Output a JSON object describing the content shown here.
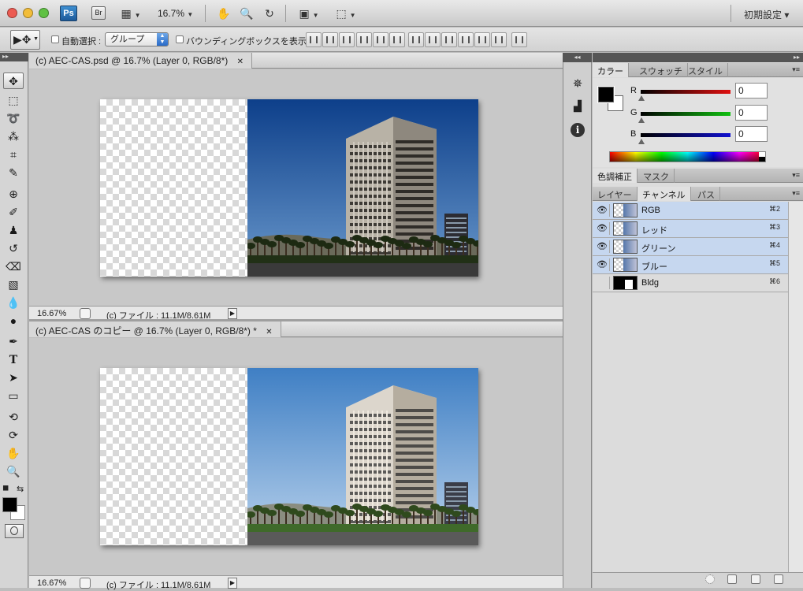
{
  "app": {
    "logo": "Ps",
    "bridge": "Br",
    "zoom": "16.7%",
    "workspace": "初期設定 ▾"
  },
  "options": {
    "auto_select_label": "自動選択 :",
    "auto_select_value": "グループ",
    "bounding_box_label": "バウンディングボックスを表示"
  },
  "documents": [
    {
      "tab_title": "(c) AEC-CAS.psd @ 16.7% (Layer 0, RGB/8*)",
      "status_zoom": "16.67%",
      "status_file": "(c) ファイル : 11.1M/8.61M"
    },
    {
      "tab_title": "(c) AEC-CAS のコピー @ 16.7% (Layer 0, RGB/8*) *",
      "status_zoom": "16.67%",
      "status_file": "(c) ファイル : 11.1M/8.61M"
    }
  ],
  "color_panel": {
    "tabs": [
      "カラー",
      "スウォッチ",
      "スタイル"
    ],
    "sliders": [
      {
        "label": "R",
        "value": "0",
        "color": "#e01010"
      },
      {
        "label": "G",
        "value": "0",
        "color": "#10c010"
      },
      {
        "label": "B",
        "value": "0",
        "color": "#1010d0"
      }
    ],
    "foreground": "#000000",
    "background": "#ffffff"
  },
  "adjust_panel": {
    "tabs": [
      "色調補正",
      "マスク"
    ]
  },
  "channels_panel": {
    "tabs": [
      "レイヤー",
      "チャンネル",
      "パス"
    ],
    "channels": [
      {
        "name": "RGB",
        "shortcut": "⌘2",
        "visible": true,
        "selected": true
      },
      {
        "name": "レッド",
        "shortcut": "⌘3",
        "visible": true,
        "selected": true
      },
      {
        "name": "グリーン",
        "shortcut": "⌘4",
        "visible": true,
        "selected": true
      },
      {
        "name": "ブルー",
        "shortcut": "⌘5",
        "visible": true,
        "selected": true
      },
      {
        "name": "Bldg",
        "shortcut": "⌘6",
        "visible": false,
        "selected": false
      }
    ]
  },
  "icons": {
    "eye": "👁",
    "close": "✕",
    "play": "▶",
    "panel_menu": "▾≡",
    "collapse_left": "◂◂",
    "expand_right": "▸▸"
  }
}
